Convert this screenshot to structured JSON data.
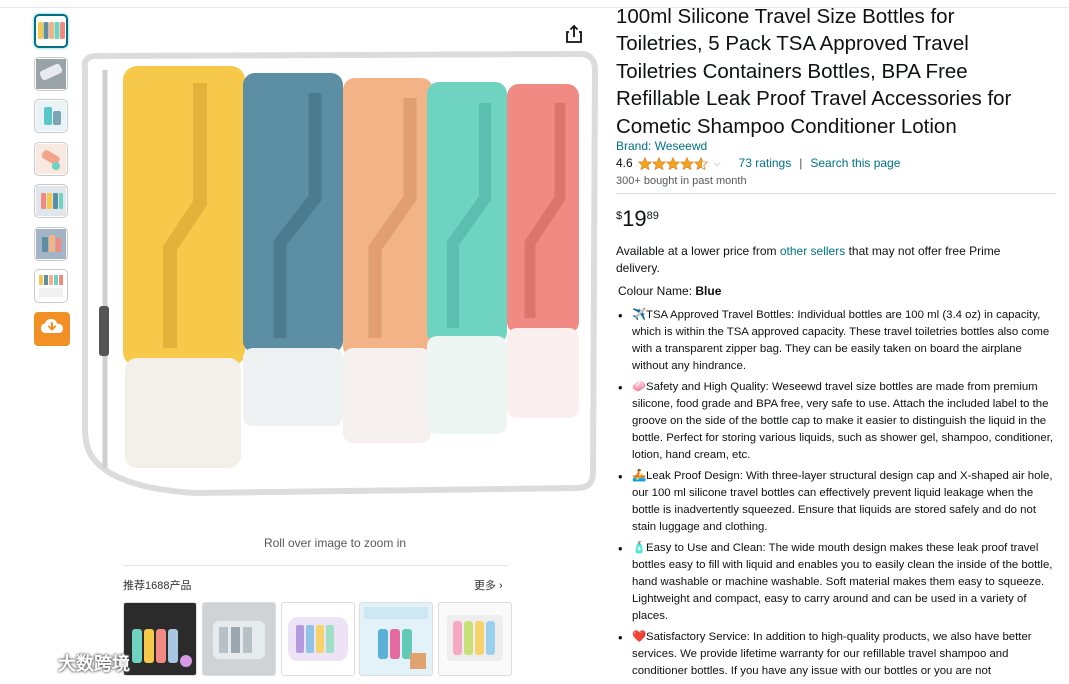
{
  "thumbnails": [
    {
      "name": "thumb-1",
      "selected": true
    },
    {
      "name": "thumb-2"
    },
    {
      "name": "thumb-3"
    },
    {
      "name": "thumb-4"
    },
    {
      "name": "thumb-5"
    },
    {
      "name": "thumb-6"
    },
    {
      "name": "thumb-7"
    }
  ],
  "zoom_hint": "Roll over image to zoom in",
  "recommended": {
    "title": "推荐1688产品",
    "more": "更多 ›"
  },
  "watermark": "大数跨境",
  "product": {
    "title": "100ml Silicone Travel Size Bottles for Toiletries, 5 Pack TSA Approved Travel Toiletries Containers Bottles, BPA Free Refillable Leak Proof Travel Accessories for Cometic Shampoo Conditioner Lotion",
    "brand": "Brand: Weseewd",
    "rating": "4.6",
    "rating_value": 4.6,
    "ratings_count": "73 ratings",
    "search_page": "Search this page",
    "separator": "|",
    "bought": "300+ bought in past month",
    "price_currency": "$",
    "price_whole": "19",
    "price_fraction": "89",
    "availability_pre": "Available at a lower price from ",
    "availability_link": "other sellers",
    "availability_post": " that may not offer free Prime delivery.",
    "colour_label": "Colour Name: ",
    "colour_value": "Blue"
  },
  "bullets": [
    {
      "emoji": "✈️",
      "text": "TSA Approved Travel Bottles: Individual bottles are 100 ml (3.4 oz) in capacity, which is within the TSA approved capacity. These travel toiletries bottles also come with a transparent zipper bag. They can be easily taken on board the airplane without any hindrance."
    },
    {
      "emoji": "🧼",
      "text": "Safety and High Quality: Weseewd travel size bottles are made from premium silicone, food grade and BPA free, very safe to use. Attach the included label to the groove on the side of the bottle cap to make it easier to distinguish the liquid in the bottle. Perfect for storing various liquids, such as shower gel, shampoo, conditioner, lotion, hand cream, etc."
    },
    {
      "emoji": "🚣",
      "text": "Leak Proof Design: With three-layer structural design cap and X-shaped air hole, our 100 ml silicone travel bottles can effectively prevent liquid leakage when the bottle is inadvertently squeezed. Ensure that liquids are stored safely and do not stain luggage and clothing."
    },
    {
      "emoji": "🧴",
      "text": "Easy to Use and Clean: The wide mouth design makes these leak proof travel bottles easy to fill with liquid and enables you to easily clean the inside of the bottle, hand washable or machine washable. Soft material makes them easy to squeeze. Lightweight and compact, easy to carry around and can be used in a variety of places."
    },
    {
      "emoji": "❤️",
      "text": "Satisfactory Service: In addition to high-quality products, we also have better services. We provide lifetime warranty for our refillable travel shampoo and conditioner bottles. If you have any issue with our bottles or you are not"
    }
  ],
  "colors": {
    "link": "#007185",
    "star": "#f0a61c",
    "download_button": "#f29026",
    "bottle_yellow": "#f7c94a",
    "bottle_blue": "#5c8fa3",
    "bottle_peach": "#f2b387",
    "bottle_mint": "#6fd3c2",
    "bottle_coral": "#f08a82"
  },
  "icons": {
    "share": "share-icon",
    "download": "download-cloud-icon",
    "watermark_logo": "watermark-logo-icon"
  }
}
